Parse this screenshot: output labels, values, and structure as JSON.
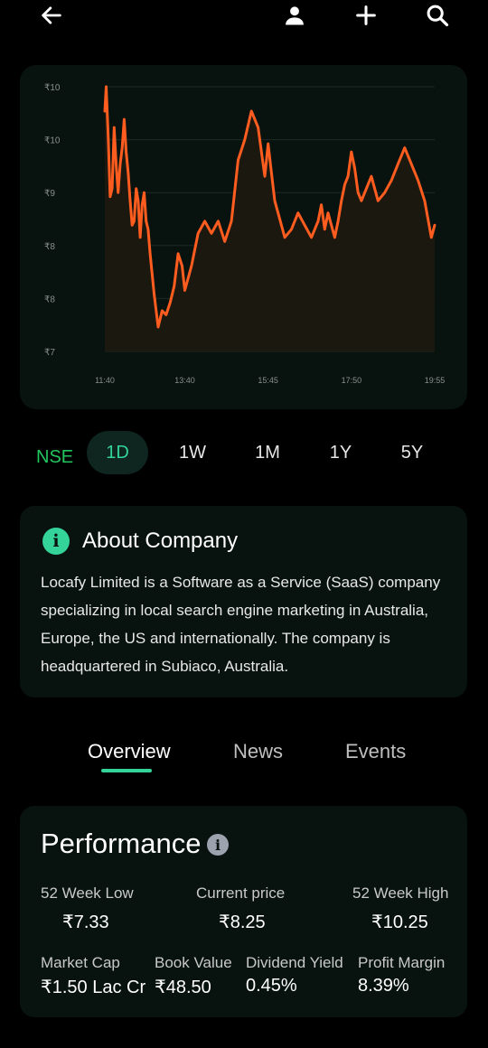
{
  "topbar": {
    "icons": [
      "back-arrow-icon",
      "user-icon",
      "plus-icon",
      "search-icon"
    ]
  },
  "chart_data": {
    "type": "line",
    "y_tick_labels": [
      "₹10",
      "₹10",
      "₹9",
      "₹8",
      "₹8",
      "₹7"
    ],
    "x_tick_labels": [
      "11:40",
      "13:40",
      "15:45",
      "17:50",
      "19:55"
    ],
    "ylim": [
      7.0,
      10.25
    ],
    "grid": true,
    "line_color": "#ff5c1f",
    "series": [
      {
        "values": [
          9.95,
          10.25,
          9.65,
          8.9,
          9.0,
          9.75,
          9.3,
          8.95,
          9.3,
          9.5,
          9.85,
          9.45,
          9.2,
          8.85,
          8.55,
          8.6,
          9.0,
          8.85,
          8.4,
          8.8,
          8.95,
          8.6,
          8.5,
          8.2,
          7.7,
          7.3,
          7.5,
          7.45,
          7.6,
          7.8,
          8.2,
          8.05,
          7.75,
          8.05,
          8.45,
          8.6,
          8.45,
          8.6,
          8.35,
          8.6,
          9.35,
          9.6,
          9.95,
          9.75,
          9.15,
          9.55,
          9.2,
          8.85,
          8.7,
          8.4,
          8.5,
          8.7,
          8.55,
          8.4,
          8.6,
          8.8,
          8.5,
          8.7,
          8.55,
          8.4,
          8.6,
          8.85,
          9.05,
          9.15,
          9.45,
          9.25,
          8.95,
          8.85,
          8.95,
          9.15,
          8.85,
          8.95,
          9.1,
          9.3,
          9.5,
          9.3,
          9.1,
          8.85,
          8.4,
          8.55
        ],
        "x": [
          "11:40",
          "11:42",
          "11:45",
          "11:48",
          "11:51",
          "11:54",
          "11:57",
          "12:00",
          "12:03",
          "12:06",
          "12:09",
          "12:12",
          "12:15",
          "12:18",
          "12:21",
          "12:24",
          "12:27",
          "12:30",
          "12:33",
          "12:36",
          "12:39",
          "12:42",
          "12:45",
          "12:48",
          "12:54",
          "13:00",
          "13:06",
          "13:12",
          "13:18",
          "13:24",
          "13:30",
          "13:36",
          "13:40",
          "13:50",
          "14:00",
          "14:10",
          "14:20",
          "14:30",
          "14:40",
          "14:50",
          "15:00",
          "15:10",
          "15:20",
          "15:30",
          "15:40",
          "15:45",
          "15:50",
          "15:55",
          "16:00",
          "16:10",
          "16:20",
          "16:30",
          "16:40",
          "16:50",
          "17:00",
          "17:05",
          "17:10",
          "17:15",
          "17:20",
          "17:25",
          "17:30",
          "17:35",
          "17:40",
          "17:45",
          "17:50",
          "17:55",
          "18:00",
          "18:05",
          "18:10",
          "18:20",
          "18:30",
          "18:40",
          "18:50",
          "19:00",
          "19:10",
          "19:20",
          "19:30",
          "19:40",
          "19:50",
          "19:55"
        ]
      }
    ]
  },
  "range": {
    "exchange": "NSE",
    "options": [
      "1D",
      "1W",
      "1M",
      "1Y",
      "5Y"
    ],
    "active": "1D"
  },
  "about": {
    "title": "About Company",
    "text": "Locafy Limited is a Software as a Service (SaaS) company specializing in local search engine marketing in Australia, Europe, the US and internationally. The company is headquartered in Subiaco, Australia."
  },
  "tabs": [
    "Overview",
    "News",
    "Events"
  ],
  "performance": {
    "title": "Performance",
    "low_label": "52 Week Low",
    "low_value": "₹7.33",
    "current_label": "Current price",
    "current_value": "₹8.25",
    "high_label": "52 Week High",
    "high_value": "₹10.25",
    "mcap_label": "Market Cap",
    "mcap_value": "₹1.50 Lac Cr",
    "book_label": "Book Value",
    "book_value": "₹48.50",
    "div_label": "Dividend Yield",
    "div_value": "0.45%",
    "margin_label": "Profit Margin",
    "margin_value": "8.39%"
  }
}
